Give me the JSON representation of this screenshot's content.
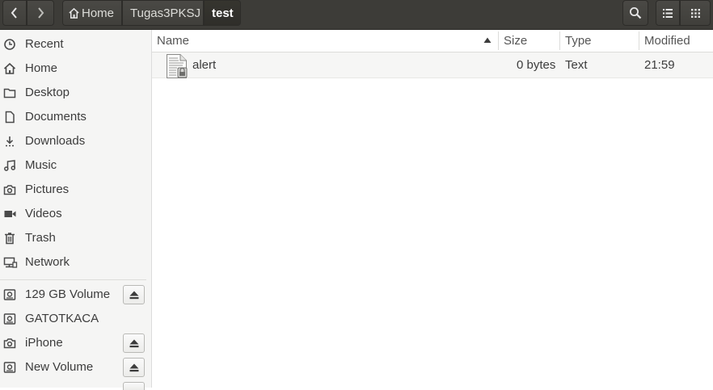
{
  "header": {
    "breadcrumbs": [
      "Home",
      "Tugas3PKSJ",
      "test"
    ]
  },
  "sidebar": {
    "places": [
      {
        "label": "Recent",
        "icon": "clock-icon"
      },
      {
        "label": "Home",
        "icon": "home-icon"
      },
      {
        "label": "Desktop",
        "icon": "folder-icon"
      },
      {
        "label": "Documents",
        "icon": "document-icon"
      },
      {
        "label": "Downloads",
        "icon": "download-icon"
      },
      {
        "label": "Music",
        "icon": "music-icon"
      },
      {
        "label": "Pictures",
        "icon": "camera-icon"
      },
      {
        "label": "Videos",
        "icon": "video-icon"
      },
      {
        "label": "Trash",
        "icon": "trash-icon"
      },
      {
        "label": "Network",
        "icon": "network-icon"
      }
    ],
    "devices": [
      {
        "label": "129 GB Volume",
        "icon": "drive-icon",
        "eject": true
      },
      {
        "label": "GATOTKACA",
        "icon": "drive-icon",
        "eject": false
      },
      {
        "label": "iPhone",
        "icon": "camera-icon",
        "eject": true
      },
      {
        "label": "New Volume",
        "icon": "drive-icon",
        "eject": true
      }
    ]
  },
  "columns": {
    "name": "Name",
    "size": "Size",
    "type": "Type",
    "modified": "Modified"
  },
  "files": [
    {
      "name": "alert",
      "size": "0 bytes",
      "type": "Text",
      "modified": "21:59",
      "icon": "locked-text-file-icon"
    }
  ],
  "colors": {
    "header_bg": "#3d3c38",
    "sidebar_bg": "#f5f5f4",
    "row_bg": "#f6f6f5"
  }
}
